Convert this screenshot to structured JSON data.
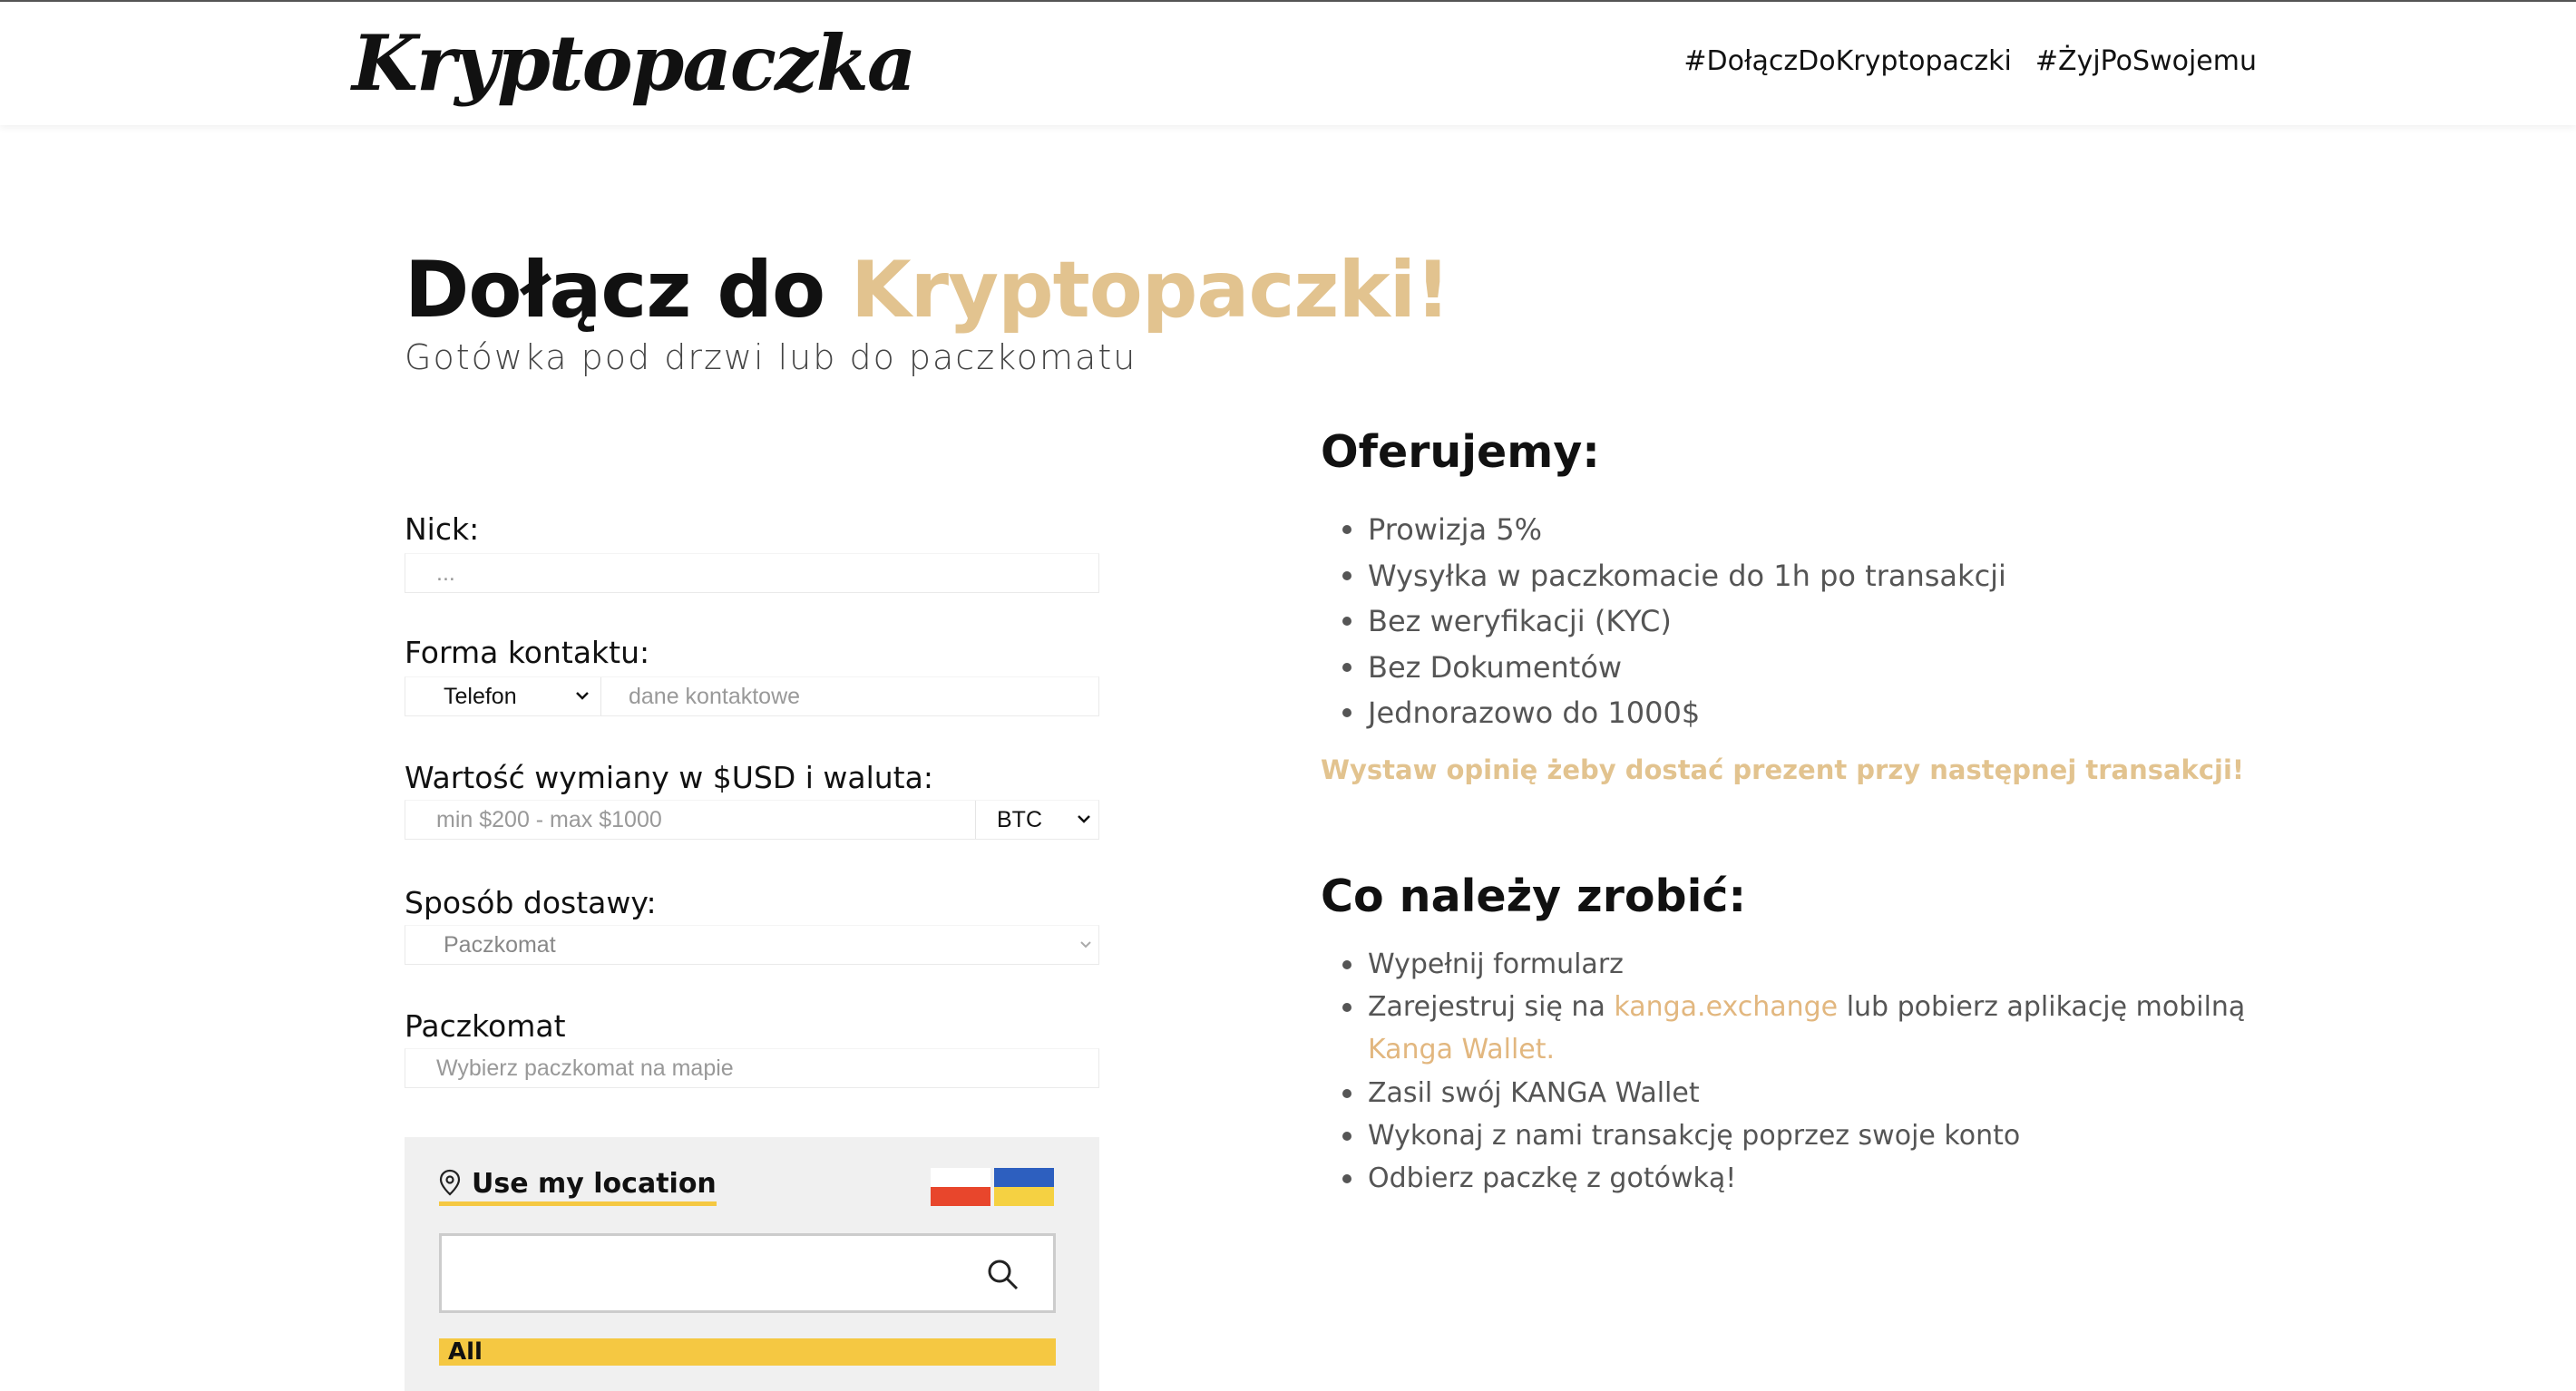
{
  "header": {
    "logo": "Kryptopaczka",
    "nav": [
      "#DołączDoKryptopaczki",
      "#ŻyjPoSwojemu"
    ]
  },
  "hero": {
    "title_main": "Dołącz do ",
    "title_accent": "Kryptopaczki!",
    "subtitle": "Gotówka pod drzwi lub do paczkomatu"
  },
  "form": {
    "nick": {
      "label": "Nick:",
      "placeholder": "..."
    },
    "contact": {
      "label": "Forma kontaktu:",
      "selected": "Telefon",
      "placeholder": "dane kontaktowe"
    },
    "amount": {
      "label": "Wartość wymiany w $USD i waluta:",
      "placeholder": "min $200 - max $1000",
      "currency": "BTC"
    },
    "delivery": {
      "label": "Sposób dostawy:",
      "selected": "Paczkomat"
    },
    "locker": {
      "label": "Paczkomat",
      "placeholder": "Wybierz paczkomat na mapie"
    }
  },
  "map_widget": {
    "use_location": "Use my location",
    "filter_all": "All",
    "flags": [
      {
        "name": "poland",
        "top": "#ffffff",
        "bottom": "#e8462c"
      },
      {
        "name": "ukraine",
        "top": "#2d5fbf",
        "bottom": "#f5d142"
      }
    ],
    "accent_color": "#f5c842"
  },
  "offer": {
    "heading": "Oferujemy:",
    "items": [
      "Prowizja 5%",
      "Wysyłka w paczkomacie do 1h po transakcji",
      "Bez weryfikacji (KYC)",
      "Bez Dokumentów",
      "Jednorazowo do 1000$"
    ],
    "promo": "Wystaw opinię żeby dostać prezent przy następnej transakcji!"
  },
  "steps": {
    "heading": "Co należy zrobić:",
    "step1": "Wypełnij formularz",
    "step2_a": "Zarejestruj się na ",
    "step2_link": "kanga.exchange",
    "step2_b": " lub pobierz aplikację mobilną",
    "step2_link2": "Kanga Wallet.",
    "step3": "Zasil swój KANGA Wallet",
    "step4": "Wykonaj z nami transakcję poprzez swoje konto",
    "step5": "Odbierz paczkę z gotówką!"
  },
  "colors": {
    "accent": "#e2c38f",
    "link": "#e2b77f",
    "text_muted": "#555555"
  }
}
